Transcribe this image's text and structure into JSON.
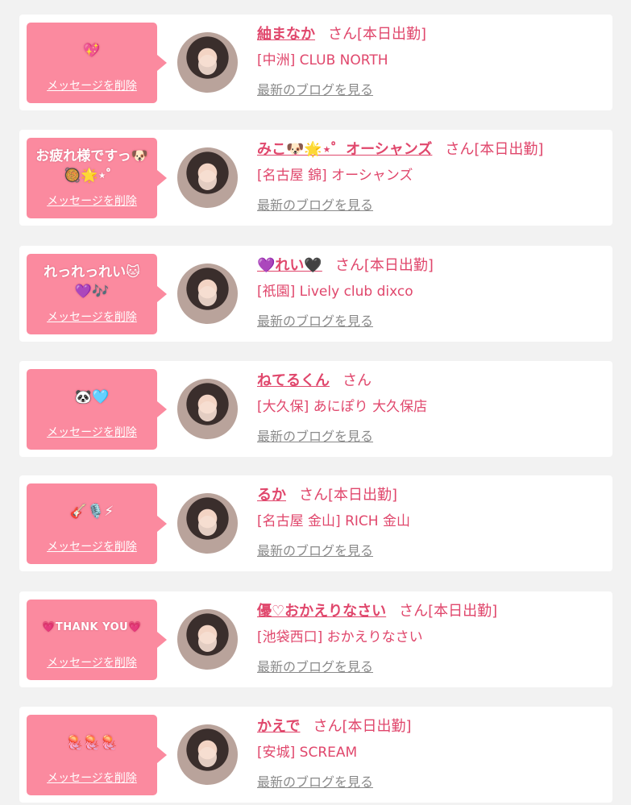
{
  "delete_label": "メッセージを削除",
  "blog_label": "最新のブログを見る",
  "accent_color": "#fb8a9f",
  "name_color": "#e0476c",
  "cards": [
    {
      "message": "💖",
      "name": "紬まなか",
      "honor": "さん[本日出勤]",
      "shop": "[中洲] CLUB NORTH"
    },
    {
      "message": "お疲れ様ですっ🐶\n🥘🌟⋆゜",
      "name": "みこ🐶🌟⋆゜オーシャンズ",
      "honor": "さん[本日出勤]",
      "shop": "[名古屋 錦] オーシャンズ"
    },
    {
      "message": "れっれっれい🐱\n💜🎶",
      "name": "💜れい🖤",
      "honor": "さん[本日出勤]",
      "shop": "[祇園] Lively club dixco"
    },
    {
      "message": "🐼🩵",
      "name": "ねてるくん",
      "honor": "さん",
      "shop": "[大久保] あにぽり 大久保店"
    },
    {
      "message": "🎸🎙️⚡",
      "name": "るか",
      "honor": "さん[本日出勤]",
      "shop": "[名古屋 金山] RICH 金山"
    },
    {
      "message": "💗THANK YOU💗",
      "name": "優♡おかえりなさい",
      "honor": "さん[本日出勤]",
      "shop": "[池袋西口] おかえりなさい"
    },
    {
      "message": "🪼🪼🪼",
      "name": "かえで",
      "honor": "さん[本日出勤]",
      "shop": "[安城] SCREAM"
    }
  ]
}
